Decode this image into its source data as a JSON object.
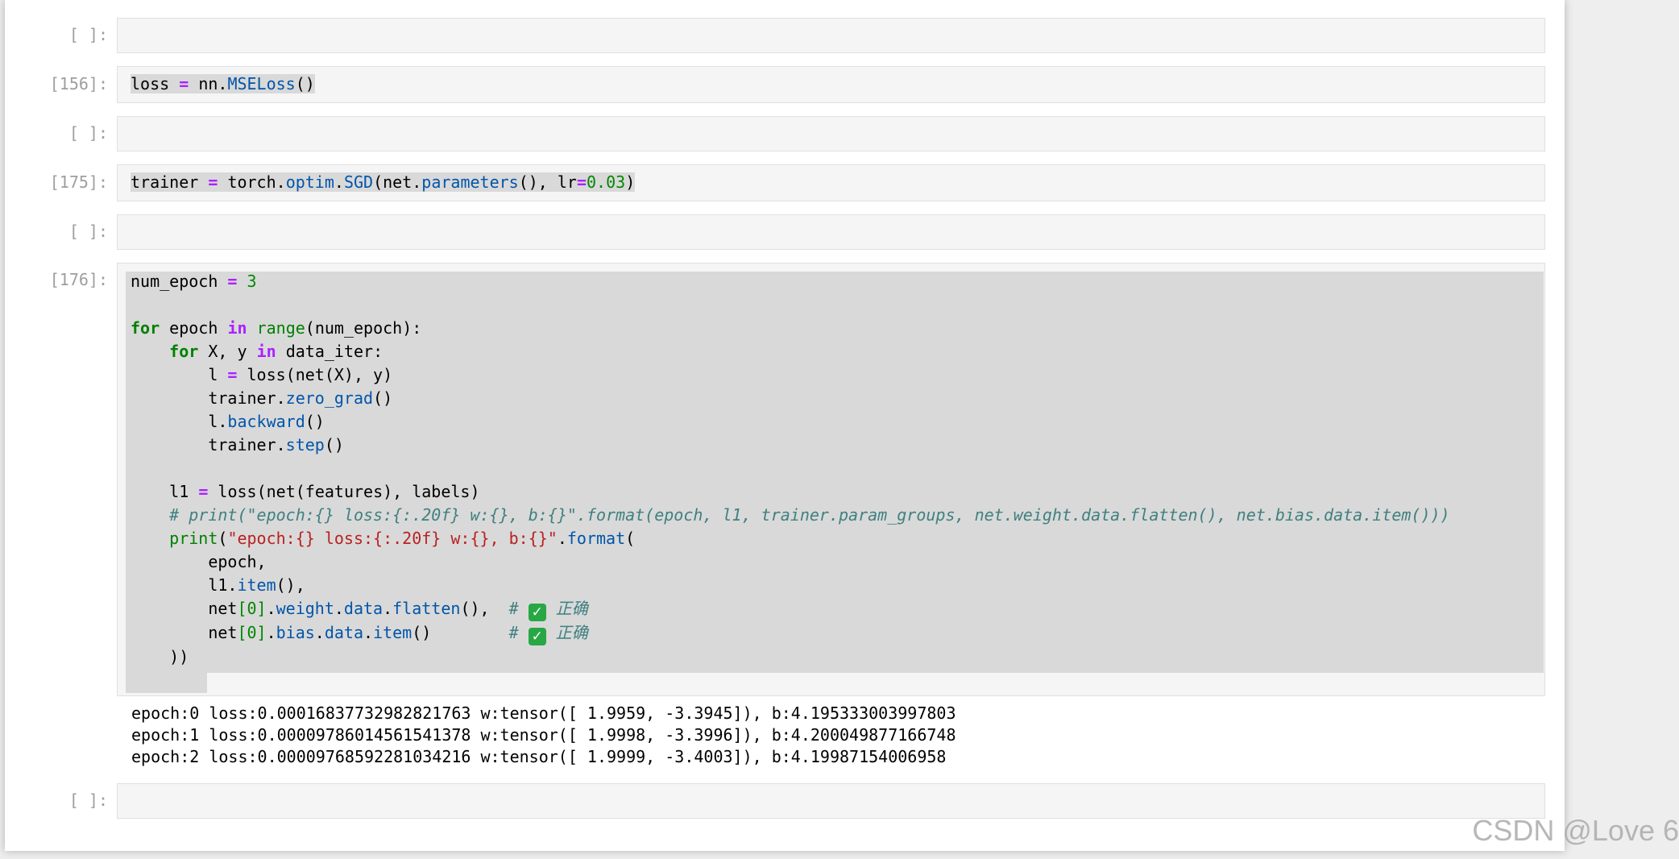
{
  "cells": [
    {
      "prompt": "[ ]:"
    },
    {
      "prompt": "[156]:",
      "code": {
        "var": "loss",
        "eq": "=",
        "obj": "nn.",
        "fn": "MSELoss",
        "rest": "()"
      }
    },
    {
      "prompt": "[ ]:"
    },
    {
      "prompt": "[175]:",
      "code": {
        "var": "trainer",
        "eq": "=",
        "p1": "torch.",
        "p2": "optim",
        "p3": ".",
        "p4": "SGD",
        "p5": "(net.",
        "p6": "parameters",
        "p7": "(), lr",
        "p8": "=",
        "p9": "0.03",
        "p10": ")"
      }
    },
    {
      "prompt": "[ ]:"
    },
    {
      "prompt": "[176]:"
    },
    {
      "prompt": "[ ]:"
    }
  ],
  "loop_cell": {
    "l1_var": "num_epoch",
    "l1_eq": "=",
    "l1_num": "3",
    "l3_for": "for",
    "l3_a": "epoch",
    "l3_in": "in",
    "l3_range": "range",
    "l3_b": "(num_epoch):",
    "l4_for": "for",
    "l4_a": "X, y",
    "l4_in": "in",
    "l4_b": "data_iter:",
    "l5_a": "l",
    "l5_eq": "=",
    "l5_b": "loss(net(X), y)",
    "l6_a": "trainer.",
    "l6_fn": "zero_grad",
    "l6_b": "()",
    "l7_a": "l.",
    "l7_fn": "backward",
    "l7_b": "()",
    "l8_a": "trainer.",
    "l8_fn": "step",
    "l8_b": "()",
    "l10_a": "l1",
    "l10_eq": "=",
    "l10_b": "loss(net(features), labels)",
    "l11_comment": "# print(\"epoch:{} loss:{:.20f} w:{}, b:{}\".format(epoch, l1, trainer.param_groups, net.weight.data.flatten(), net.bias.data.item()))",
    "l12_print": "print",
    "l12_a": "(",
    "l12_str": "\"epoch:{} loss:{:.20f} w:{}, b:{}\"",
    "l12_b": ".",
    "l12_fn": "format",
    "l12_c": "(",
    "l13": "epoch,",
    "l14_a": "l1.",
    "l14_fn": "item",
    "l14_b": "(),",
    "l15_a": "net",
    "l15_idx": "[0]",
    "l15_b": ".",
    "l15_f1": "weight",
    "l15_c": ".",
    "l15_f2": "data",
    "l15_d": ".",
    "l15_f3": "flatten",
    "l15_e": "(),  ",
    "l15_cm": "# ",
    "l15_check": "✓",
    "l15_cm2": " 正确",
    "l16_a": "net",
    "l16_idx": "[0]",
    "l16_b": ".",
    "l16_f1": "bias",
    "l16_c": ".",
    "l16_f2": "data",
    "l16_d": ".",
    "l16_f3": "item",
    "l16_e": "()        ",
    "l16_cm": "# ",
    "l16_check": "✓",
    "l16_cm2": " 正确",
    "l17": "))"
  },
  "output_lines": [
    "epoch:0 loss:0.00016837732982821763 w:tensor([ 1.9959, -3.3945]), b:4.195333003997803",
    "epoch:1 loss:0.00009786014561541378 w:tensor([ 1.9998, -3.3996]), b:4.200049877166748",
    "epoch:2 loss:0.00009768592281034216 w:tensor([ 1.9999, -3.4003]), b:4.19987154006958"
  ],
  "watermark": "CSDN @Love 6"
}
